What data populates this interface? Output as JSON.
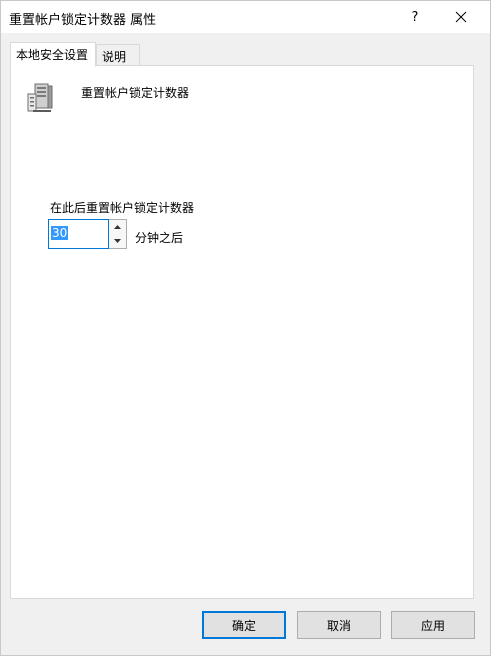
{
  "window": {
    "title": "重置帐户锁定计数器 属性",
    "help_label": "?"
  },
  "tabs": [
    {
      "label": "本地安全设置",
      "active": true
    },
    {
      "label": "说明",
      "active": false
    }
  ],
  "policy": {
    "icon": "server-icon",
    "name": "重置帐户锁定计数器"
  },
  "setting": {
    "label": "在此后重置帐户锁定计数器",
    "value": "30",
    "unit": "分钟之后"
  },
  "buttons": {
    "ok": "确定",
    "cancel": "取消",
    "apply": "应用"
  },
  "colors": {
    "accent": "#0078d7",
    "selection": "#3399ff"
  }
}
